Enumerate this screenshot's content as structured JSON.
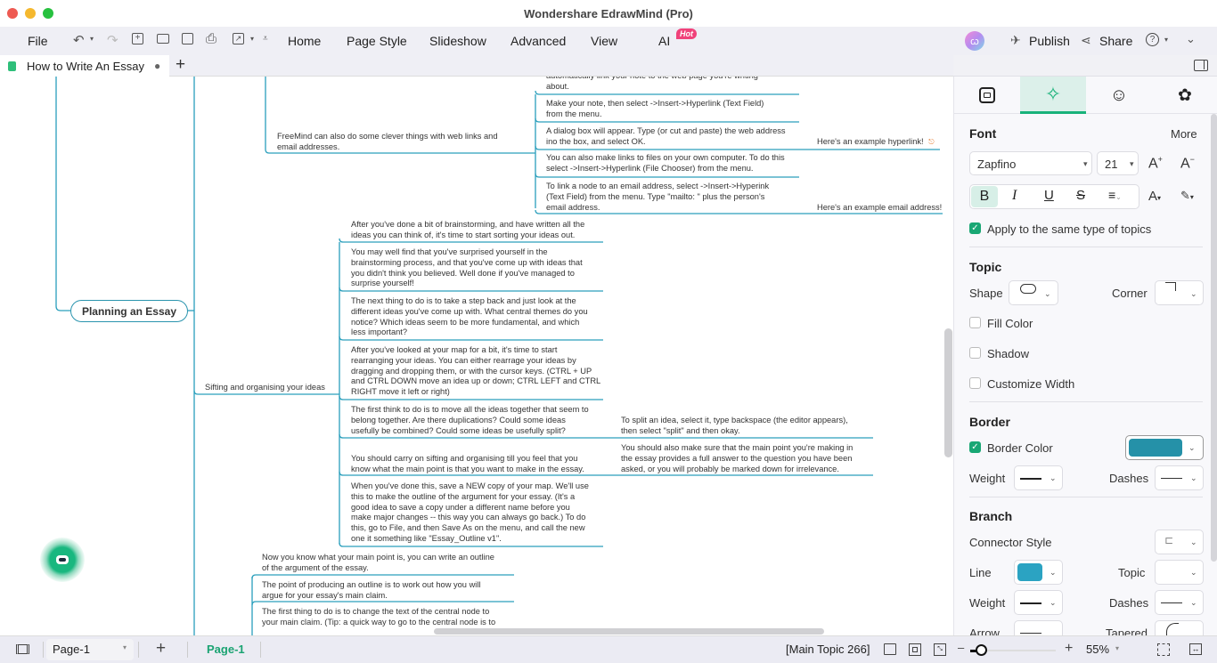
{
  "window": {
    "title": "Wondershare EdrawMind (Pro)",
    "traffic_lights": {
      "close": "#ee5a52",
      "minimize": "#f5b82e",
      "zoom": "#27c13f"
    }
  },
  "menubar": {
    "file": "File",
    "toolbar_icons": [
      "undo-icon",
      "redo-icon",
      "new-icon",
      "open-folder-icon",
      "save-icon",
      "print-icon",
      "export-icon",
      "more-icon"
    ],
    "items": [
      "Home",
      "Page Style",
      "Slideshow",
      "Advanced",
      "View",
      "AI"
    ],
    "ai_badge": "Hot",
    "publish": "Publish",
    "share": "Share"
  },
  "tabs": {
    "document": "How to Write An Essay",
    "unsaved_dot": "●",
    "add": "+"
  },
  "canvas": {
    "main_topic": "Planning an Essay",
    "subtopics": {
      "web_links": "FreeMind can also do some clever things with web links and\nemail addresses.",
      "sifting": "Sifting and organising your ideas"
    },
    "web_notes": [
      "automatically link your note to the web page you're writing\nabout.",
      "Make your note, then select ->Insert->Hyperlink (Text Field)\nfrom the menu.",
      "A dialog box will appear. Type (or cut and paste) the web address\nino the box, and select OK.",
      "You can also make links to files on your own computer. To do this\nselect ->Insert->Hyperlink (File Chooser) from the menu.",
      "To link a node to an email address, select ->Insert->Hyperink\n(Text Field) from the menu. Type \"mailto: \" plus the person's\nemail address."
    ],
    "web_examples": [
      "Here's an example hyperlink!",
      "Here's an example email address!"
    ],
    "sifting_notes": [
      "After you've done a bit of brainstorming, and have written all the\nideas you can think of, it's time to start sorting your ideas out.",
      "You may well find that you've surprised yourself in the\nbrainstorming process, and that you've come up with ideas that\nyou didn't think you believed. Well done if you've managed to\nsurprise yourself!",
      "The next thing to do is to take a step back and just look at the\ndifferent ideas you've come up with. What central themes do you\nnotice? Which ideas seem to be more fundamental, and which\nless important?",
      "After you've looked at your map for a bit, it's time to start\nrearranging your ideas. You can either rearrage your ideas by\ndragging and dropping them, or with the cursor keys. (CTRL + UP\nand CTRL DOWN move an idea up or down; CTRL LEFT and CTRL\nRIGHT move it left or right)",
      "The first think to do is to move all the ideas together that seem to\nbelong together. Are there duplications? Could some ideas\nusefully be combined? Could some ideas be usefully split?",
      "You should carry on sifting and organising till you feel that you\nknow what the main point is that you want to make in the essay.",
      "When you've done this, save a NEW copy of your map. We'll use\nthis to make the outline of the argument for your essay. (It's a\ngood idea to save a copy under a different name before you\nmake major changes -- this way you can always go back.) To do\nthis, go to File, and then Save As on the menu, and call the new\none it something like \"Essay_Outline v1\"."
    ],
    "sifting_sub": [
      "To split an idea, select it, type backspace (the editor appears),\nthen select \"split\" and then okay.",
      "You should also make sure that the main point you're making in\nthe essay provides a full answer to the question you have been\nasked, or you will probably be marked down for irrelevance."
    ],
    "outline_notes": [
      "Now you know what your main point is, you can write an outline\nof the argument of the essay.",
      "The point of producing an outline is to work out how you will\nargue for your essay's main claim.",
      "The first thing to do is to change the text of the central node to\nyour main claim. (Tip: a quick way to go to the central node is to"
    ],
    "branch_color": "#2a9fbc"
  },
  "panel": {
    "tabs": [
      "style-tab",
      "ai-format-tab",
      "icon-tab",
      "theme-tab"
    ],
    "active_tab": 1,
    "font": {
      "title": "Font",
      "more": "More",
      "family": "Zapfino",
      "size": "21",
      "apply_same": "Apply to the same type of topics",
      "apply_same_checked": true
    },
    "topic": {
      "title": "Topic",
      "shape": "Shape",
      "corner": "Corner",
      "fill_color": "Fill Color",
      "shadow": "Shadow",
      "customize_width": "Customize Width"
    },
    "border": {
      "title": "Border",
      "border_color": "Border Color",
      "border_color_checked": true,
      "color": "#2591a8",
      "weight": "Weight",
      "dashes": "Dashes"
    },
    "branch": {
      "title": "Branch",
      "connector_style": "Connector Style",
      "line": "Line",
      "line_color": "#2ba3c2",
      "topic": "Topic",
      "weight": "Weight",
      "dashes": "Dashes",
      "arrow": "Arrow",
      "tapered": "Tapered"
    }
  },
  "statusbar": {
    "page_select": "Page-1",
    "page_tab": "Page-1",
    "selection": "[Main Topic 266]",
    "zoom": "55%",
    "zoom_fraction": 0.12,
    "minus": "–",
    "plus": "+"
  }
}
